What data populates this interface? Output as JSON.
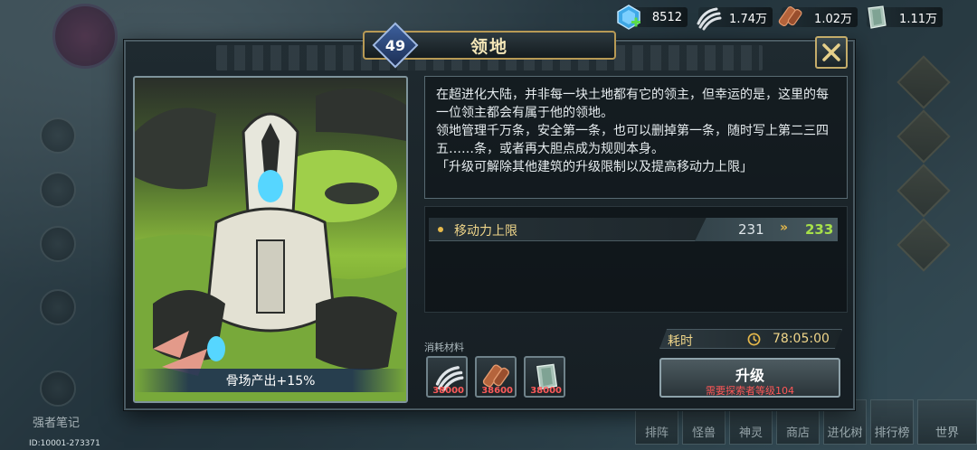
{
  "resources": [
    {
      "icon": "crystal-plus-icon",
      "value": "8512"
    },
    {
      "icon": "claw-bone-icon",
      "value": "1.74万"
    },
    {
      "icon": "wood-log-icon",
      "value": "1.02万"
    },
    {
      "icon": "stone-slab-icon",
      "value": "1.11万"
    }
  ],
  "background": {
    "left_label": "强者笔记",
    "id_text": "ID:10001-273371",
    "bottom_nav": [
      "排阵",
      "怪兽",
      "神灵",
      "商店",
      "进化树",
      "排行榜",
      "世界"
    ]
  },
  "modal": {
    "level": "49",
    "title": "领地",
    "description": "在超进化大陆，并非每一块土地都有它的领主，但幸运的是，这里的每一位领主都会有属于他的领地。\n领地管理千万条，安全第一条，也可以删掉第一条，随时写上第二三四五……条，或者再大胆点成为规则本身。\n「升级可解除其他建筑的升级限制以及提高移动力上限」",
    "art_caption": "骨场产出+15%",
    "stat": {
      "label": "移动力上限",
      "old": "231",
      "new": "233"
    },
    "materials_label": "消耗材料",
    "materials": [
      {
        "icon": "claw-bone-icon",
        "qty": "38000"
      },
      {
        "icon": "wood-log-icon",
        "qty": "38600"
      },
      {
        "icon": "stone-slab-icon",
        "qty": "38000"
      }
    ],
    "time_label": "耗时",
    "time_value": "78:05:00",
    "upgrade_label": "升级",
    "upgrade_requirement": "需要探索者等级104"
  },
  "colors": {
    "accent_gold": "#f0d68a",
    "green_value": "#a7e04a",
    "warning_red": "#ff5757"
  }
}
